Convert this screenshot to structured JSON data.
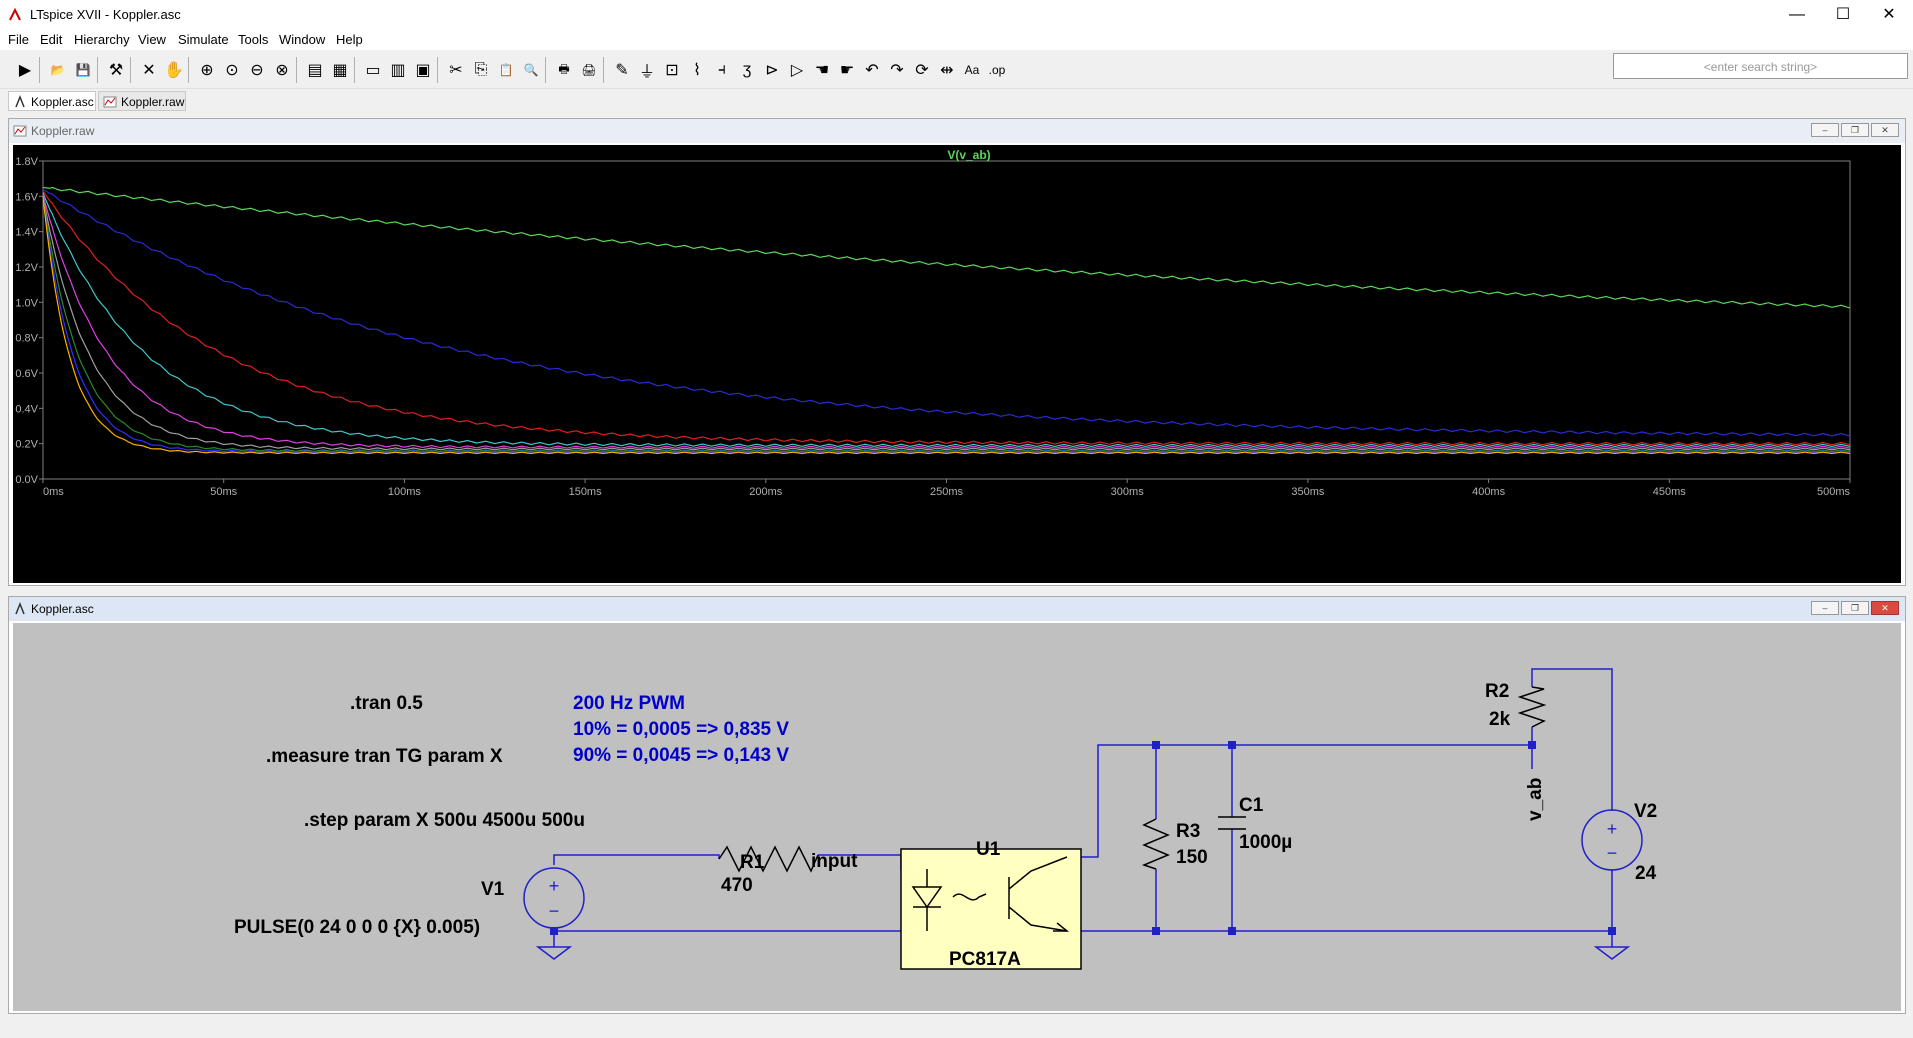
{
  "window": {
    "title": "LTspice XVII - Koppler.asc"
  },
  "menu": [
    "File",
    "Edit",
    "Hierarchy",
    "View",
    "Simulate",
    "Tools",
    "Window",
    "Help"
  ],
  "search": {
    "placeholder": "<enter search string>"
  },
  "toolbar_icons": [
    "run-icon",
    "open-icon",
    "save-icon",
    "control-panel-icon",
    "halt-icon",
    "pan-icon",
    "zoom-in-icon",
    "zoom-fit-icon",
    "zoom-out-icon",
    "zoom-cancel-icon",
    "autorange-icon",
    "mark-icon",
    "tile-horizontal-icon",
    "tile-vertical-icon",
    "cascade-icon",
    "cut-icon",
    "copy-icon",
    "paste-icon",
    "find-icon",
    "print-icon",
    "print-setup-icon",
    "wire-icon",
    "ground-icon",
    "label-net-icon",
    "resistor-icon",
    "capacitor-icon",
    "inductor-icon",
    "diode-icon",
    "component-icon",
    "move-icon",
    "drag-icon",
    "undo-icon",
    "redo-icon",
    "rotate-icon",
    "mirror-icon",
    "text-icon",
    "spice-directive-icon"
  ],
  "tabs": [
    {
      "label": "Koppler.asc"
    },
    {
      "label": "Koppler.raw"
    }
  ],
  "plot_window": {
    "title": "Koppler.raw"
  },
  "schematic_window": {
    "title": "Koppler.asc"
  },
  "colors": {
    "trace_green": "#5cd65c",
    "trace_blue": "#2b2bd6",
    "trace_red": "#e02020",
    "trace_cyan": "#40c8c8",
    "trace_magenta": "#e040e0",
    "trace_gray": "#a0a0a0",
    "trace_darkgreen": "#2a8a2a",
    "trace_navy": "#3030ff",
    "trace_orange": "#ffb000",
    "wire": "#2020c8",
    "directive_blue": "#0000c8"
  },
  "chart_data": {
    "type": "line",
    "title": "V(v_ab)",
    "xlabel": "",
    "ylabel": "",
    "xlim": [
      0,
      500
    ],
    "ylim": [
      0,
      1.8
    ],
    "xticks": [
      "0ms",
      "50ms",
      "100ms",
      "150ms",
      "200ms",
      "250ms",
      "300ms",
      "350ms",
      "400ms",
      "450ms",
      "500ms"
    ],
    "yticks": [
      "0.0V",
      "0.2V",
      "0.4V",
      "0.6V",
      "0.8V",
      "1.0V",
      "1.2V",
      "1.4V",
      "1.6V",
      "1.8V"
    ],
    "series": [
      {
        "color": "#5cd65c",
        "start": 1.65,
        "floor": 0.68,
        "tau": 420,
        "ripple": 0.013
      },
      {
        "color": "#2b2bd6",
        "start": 1.64,
        "floor": 0.235,
        "tau": 110,
        "ripple": 0.013
      },
      {
        "color": "#e02020",
        "start": 1.63,
        "floor": 0.2,
        "tau": 48,
        "ripple": 0.013
      },
      {
        "color": "#40c8c8",
        "start": 1.62,
        "floor": 0.19,
        "tau": 28,
        "ripple": 0.012
      },
      {
        "color": "#e040e0",
        "start": 1.61,
        "floor": 0.18,
        "tau": 18,
        "ripple": 0.011
      },
      {
        "color": "#a0a0a0",
        "start": 1.6,
        "floor": 0.17,
        "tau": 13,
        "ripple": 0.01
      },
      {
        "color": "#2a8a2a",
        "start": 1.6,
        "floor": 0.16,
        "tau": 10,
        "ripple": 0.009
      },
      {
        "color": "#3030ff",
        "start": 1.6,
        "floor": 0.155,
        "tau": 8.5,
        "ripple": 0.008
      },
      {
        "color": "#ffb000",
        "start": 1.6,
        "floor": 0.148,
        "tau": 7.5,
        "ripple": 0.007
      }
    ]
  },
  "schematic": {
    "directives": {
      "tran": ".tran 0.5",
      "measure": ".measure tran TG param X",
      "step": ".step param X 500u 4500u 500u"
    },
    "comment": {
      "line1": "200 Hz PWM",
      "line2": "10% = 0,0005 => 0,835 V",
      "line3": "90% = 0,0045 => 0,143 V"
    },
    "parts": {
      "r1_name": "R1",
      "r1_value": "470",
      "r2_name": "R2",
      "r2_value": "2k",
      "r3_name": "R3",
      "r3_value": "150",
      "c1_name": "C1",
      "c1_value": "1000µ",
      "u1_name": "U1",
      "u1_value": "PC817A",
      "v1_name": "V1",
      "v1_value": "PULSE(0 24 0 0 0 {X} 0.005)",
      "v2_name": "V2",
      "v2_value": "24"
    },
    "nets": {
      "input": "input",
      "v_ab": "v_ab"
    }
  }
}
